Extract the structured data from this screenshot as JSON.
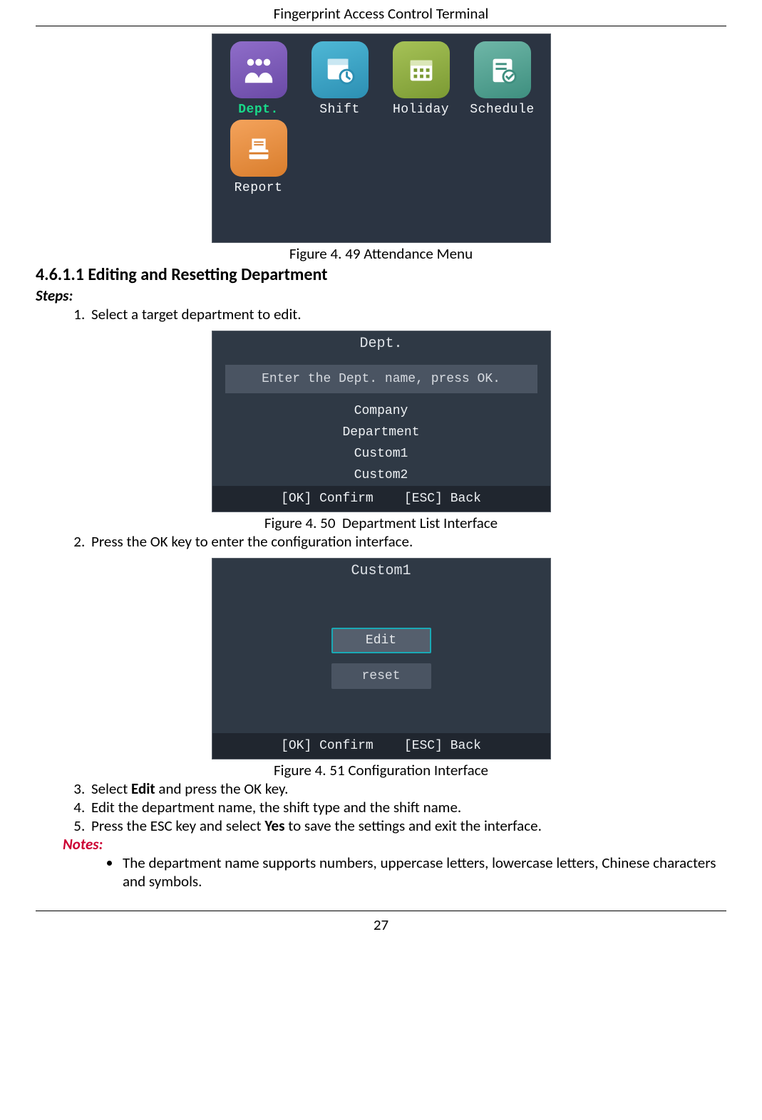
{
  "header": {
    "title": "Fingerprint Access Control Terminal"
  },
  "footer": {
    "page_number": "27"
  },
  "fig49": {
    "caption_prefix": "Figure 4. 49",
    "caption_text": "Attendance Menu",
    "menu": {
      "items_row1": [
        {
          "label": "Dept.",
          "selected": true
        },
        {
          "label": "Shift",
          "selected": false
        },
        {
          "label": "Holiday",
          "selected": false
        },
        {
          "label": "Schedule",
          "selected": false
        }
      ],
      "items_row2": [
        {
          "label": "Report",
          "selected": false
        }
      ]
    }
  },
  "section": {
    "number": "4.6.1.1",
    "heading": "Editing and Resetting Department",
    "steps_label": "Steps:",
    "steps": {
      "s1": "Select a target department to edit.",
      "s2": "Press the OK key to enter the configuration interface.",
      "s3_pre": "Select ",
      "s3_bold": "Edit",
      "s3_post": " and press the OK key.",
      "s4": "Edit the department name, the shift type and the shift name.",
      "s5_pre": "Press the ESC key and select ",
      "s5_bold": "Yes",
      "s5_post": " to save the settings and exit the interface."
    },
    "notes_label": "Notes:",
    "notes": {
      "n1": "The department name supports numbers, uppercase letters, lowercase letters, Chinese characters and symbols."
    }
  },
  "fig50": {
    "caption_prefix": "Figure 4. 50",
    "caption_text": "Department List Interface",
    "screen": {
      "title": "Dept.",
      "hint": "Enter the Dept. name, press OK.",
      "items": [
        "Company",
        "Department",
        "Custom1",
        "Custom2"
      ],
      "footer_ok": "[OK] Confirm",
      "footer_esc": "[ESC] Back"
    }
  },
  "fig51": {
    "caption_prefix": "Figure 4. 51",
    "caption_text": "Configuration Interface",
    "screen": {
      "title": "Custom1",
      "btn_edit": "Edit",
      "btn_reset": "reset",
      "footer_ok": "[OK] Confirm",
      "footer_esc": "[ESC] Back"
    }
  }
}
